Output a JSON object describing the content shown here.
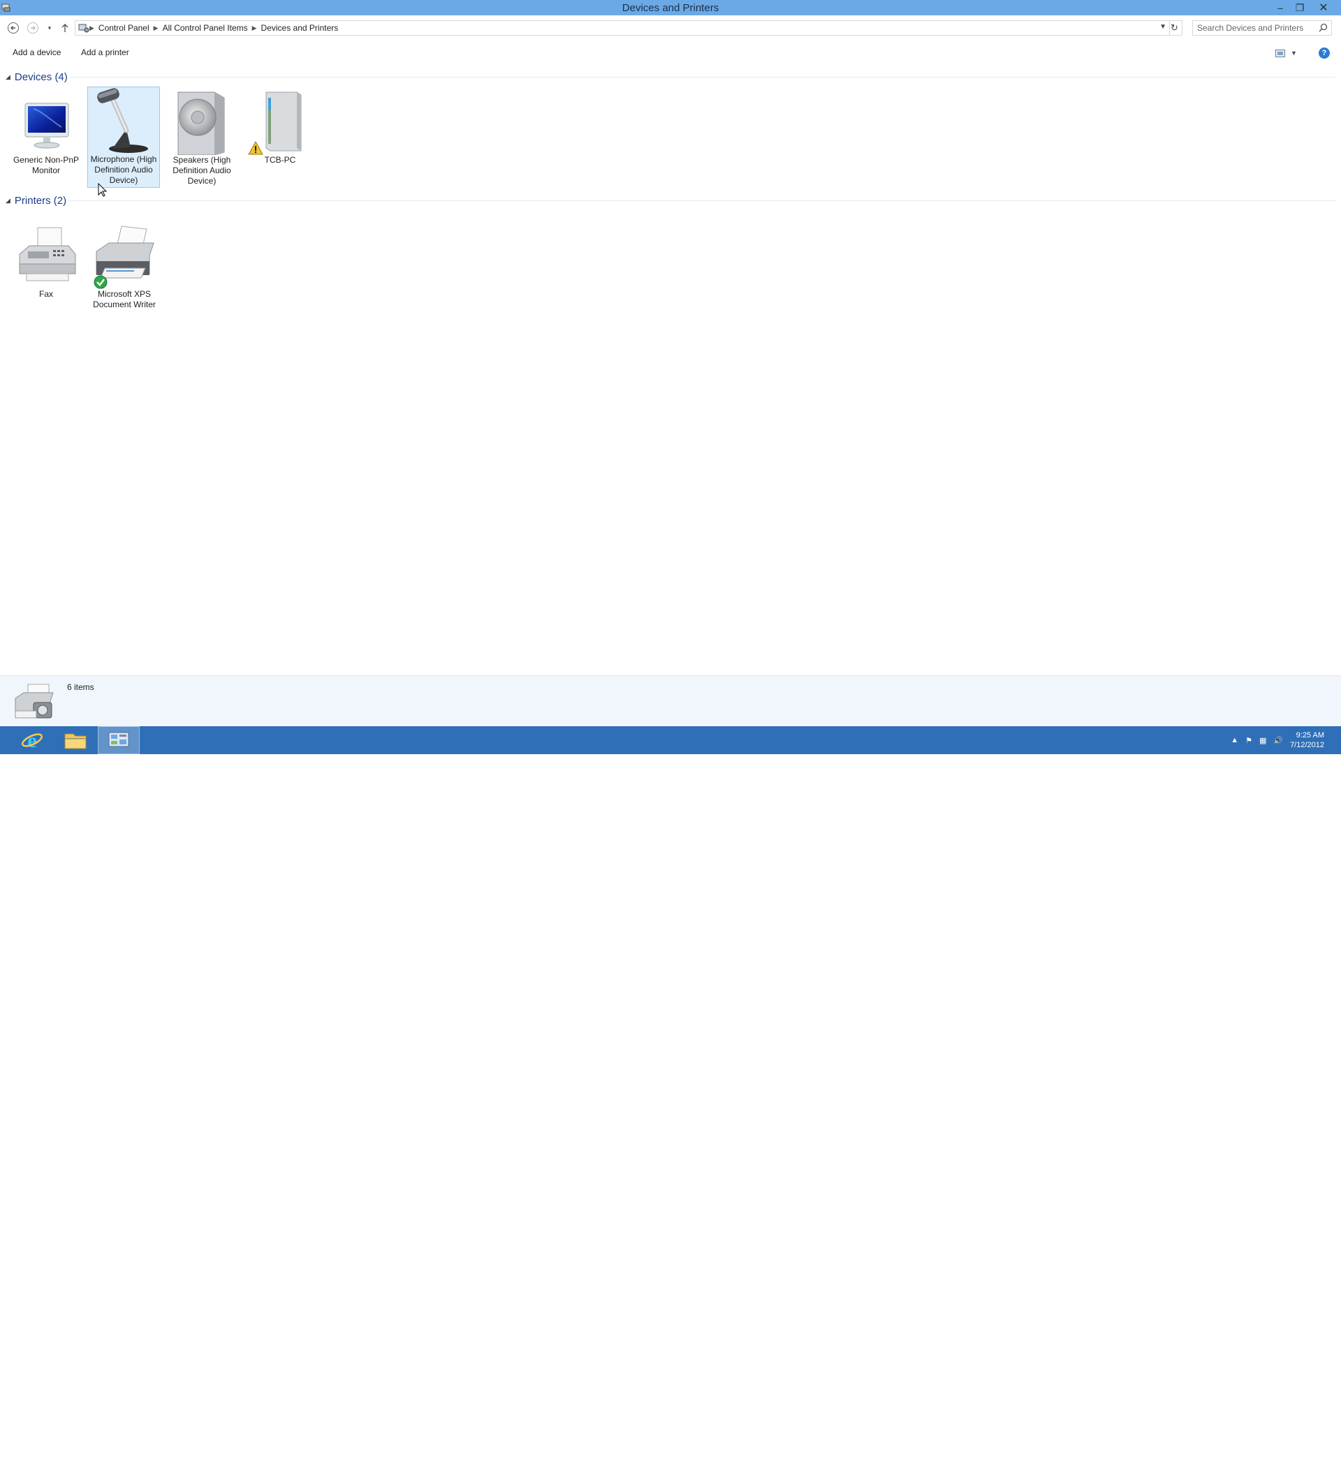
{
  "window": {
    "title": "Devices and Printers"
  },
  "address": {
    "crumbs": [
      "Control Panel",
      "All Control Panel Items",
      "Devices and Printers"
    ],
    "search_placeholder": "Search Devices and Printers"
  },
  "commands": {
    "add_device": "Add a device",
    "add_printer": "Add a printer"
  },
  "groups": {
    "devices": {
      "header": "Devices (4)",
      "items": [
        {
          "label": "Generic Non-PnP Monitor",
          "icon": "monitor-icon",
          "selected": false
        },
        {
          "label": "Microphone (High Definition Audio Device)",
          "icon": "microphone-icon",
          "selected": true
        },
        {
          "label": "Speakers (High Definition Audio Device)",
          "icon": "speaker-icon",
          "selected": false
        },
        {
          "label": "TCB-PC",
          "icon": "computer-tower-icon",
          "selected": false,
          "badge": "warning-icon"
        }
      ]
    },
    "printers": {
      "header": "Printers (2)",
      "items": [
        {
          "label": "Fax",
          "icon": "fax-icon",
          "selected": false
        },
        {
          "label": "Microsoft XPS Document Writer",
          "icon": "printer-icon",
          "selected": false,
          "badge": "default-check-icon"
        }
      ]
    }
  },
  "status": {
    "count": "6 items"
  },
  "taskbar": {
    "apps": [
      "internet-explorer-icon",
      "file-explorer-icon",
      "control-panel-icon"
    ],
    "time": "9:25 AM",
    "date": "7/12/2012"
  },
  "colors": {
    "titlebar": "#6aa9e6",
    "taskbar": "#2e6fb8",
    "group_header": "#1e3b8a",
    "selection_bg": "#dceefc",
    "selection_border": "#99c9ef"
  }
}
